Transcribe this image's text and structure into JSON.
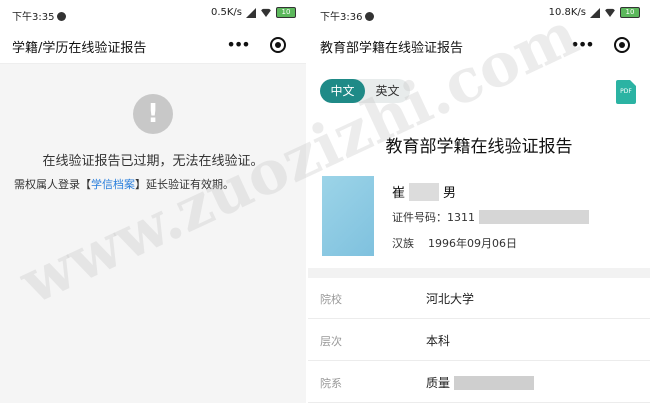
{
  "left": {
    "status": {
      "time": "下午3:35",
      "speed": "0.5K/s",
      "battery": "10"
    },
    "nav_title": "学籍/学历在线验证报告",
    "warn_symbol": "!",
    "expired_text": "在线验证报告已过期，无法在线验证。",
    "login_prefix": "需权属人登录【",
    "login_link": "学信档案",
    "login_suffix": "】延长验证有效期。"
  },
  "right": {
    "status": {
      "time": "下午3:36",
      "speed": "10.8K/s",
      "battery": "10"
    },
    "nav_title": "教育部学籍在线验证报告",
    "tabs": [
      {
        "label": "中文",
        "active": true
      },
      {
        "label": "英文",
        "active": false
      }
    ],
    "pdf_label": "PDF",
    "report_title": "教育部学籍在线验证报告",
    "person": {
      "surname": "崔",
      "gender": "男",
      "id_label": "证件号码：",
      "id_prefix": "1311",
      "ethnicity": "汉族",
      "birthdate": "1996年09月06日"
    },
    "rows": [
      {
        "key": "院校",
        "value": "河北大学"
      },
      {
        "key": "层次",
        "value": "本科"
      },
      {
        "key": "院系",
        "value": "质量"
      }
    ]
  },
  "watermark": "www.zuozizhi.com",
  "colors": {
    "accent": "#1f8a87",
    "link": "#2a7fdc",
    "pdf": "#2bb3a3"
  }
}
